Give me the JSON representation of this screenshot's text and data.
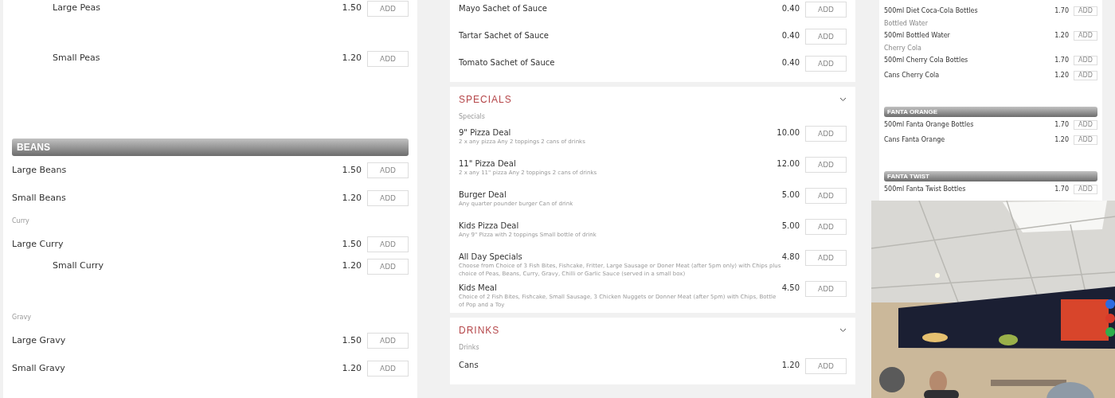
{
  "left_panel": {
    "rows": [
      {
        "kind": "item",
        "name": "Large Peas",
        "price": "1.50",
        "button": "ADD",
        "indented": true
      },
      {
        "kind": "item",
        "name": "Small Peas",
        "price": "1.20",
        "button": "ADD",
        "indented": true
      },
      {
        "kind": "banner",
        "title": "BEANS"
      },
      {
        "kind": "item",
        "name": "Large Beans",
        "price": "1.50",
        "button": "ADD",
        "indented": false
      },
      {
        "kind": "item",
        "name": "Small Beans",
        "price": "1.20",
        "button": "ADD",
        "indented": false
      },
      {
        "kind": "label",
        "title": "Curry"
      },
      {
        "kind": "item",
        "name": "Large Curry",
        "price": "1.50",
        "button": "ADD",
        "indented": false
      },
      {
        "kind": "item",
        "name": "Small Curry",
        "price": "1.20",
        "button": "ADD",
        "indented": true
      },
      {
        "kind": "label",
        "title": "Gravy"
      },
      {
        "kind": "item",
        "name": "Large Gravy",
        "price": "1.50",
        "button": "ADD",
        "indented": false
      },
      {
        "kind": "item",
        "name": "Small Gravy",
        "price": "1.20",
        "button": "ADD",
        "indented": false
      }
    ]
  },
  "middle_panel": {
    "cards": [
      {
        "rows": [
          {
            "name": "Mayo Sachet of Sauce",
            "price": "0.40",
            "button": "ADD"
          },
          {
            "name": "Tartar Sachet of Sauce",
            "price": "0.40",
            "button": "ADD"
          },
          {
            "name": "Tomato Sachet of Sauce",
            "price": "0.40",
            "button": "ADD"
          }
        ]
      },
      {
        "title": "SPECIALS",
        "label": "Specials",
        "rows": [
          {
            "name": "9\" Pizza Deal",
            "description": "2 x any pizza Any 2 toppings 2 cans of drinks",
            "price": "10.00",
            "button": "ADD"
          },
          {
            "name": "11\" Pizza Deal",
            "description": "2 x any 11\" pizza Any 2 toppings 2 cans of drinks",
            "price": "12.00",
            "button": "ADD"
          },
          {
            "name": "Burger Deal",
            "description": "Any quarter pounder burger Can of drink",
            "price": "5.00",
            "button": "ADD"
          },
          {
            "name": "Kids Pizza Deal",
            "description": "Any 9\" Pizza with 2 toppings Small bottle of drink",
            "price": "5.00",
            "button": "ADD"
          },
          {
            "name": "All Day Specials",
            "description": "Choose from Choice of 3 Fish Bites, Fishcake, Fritter, Large Sausage or Doner Meat (after 5pm only) with Chips plus choice of Peas, Beans, Curry, Gravy, Chilli or Garlic Sauce (served in a small box)",
            "price": "4.80",
            "button": "ADD"
          },
          {
            "name": "Kids Meal",
            "description": "Choice of 2 Fish Bites, Fishcake, Small Sausage, 3 Chicken Nuggets or Donner Meat (after 5pm) with Chips, Bottle of Pop and a Toy",
            "price": "4.50",
            "button": "ADD"
          }
        ]
      },
      {
        "title": "DRINKS",
        "label": "Drinks",
        "rows": [
          {
            "name": "Cans",
            "price": "1.20",
            "button": "ADD"
          }
        ]
      }
    ]
  },
  "right_panel": {
    "rows": [
      {
        "kind": "item",
        "name": "500ml Diet Coca-Cola Bottles",
        "price": "1.70",
        "button": "ADD",
        "indented": false
      },
      {
        "kind": "label",
        "title": "Bottled Water"
      },
      {
        "kind": "item",
        "name": "500ml Bottled Water",
        "price": "1.20",
        "button": "ADD",
        "indented": false
      },
      {
        "kind": "label",
        "title": "Cherry Cola"
      },
      {
        "kind": "item",
        "name": "500ml Cherry Cola Bottles",
        "price": "1.70",
        "button": "ADD",
        "indented": false
      },
      {
        "kind": "item",
        "name": "Cans Cherry Cola",
        "price": "1.20",
        "button": "ADD",
        "indented": false
      },
      {
        "kind": "banner",
        "title": "FANTA ORANGE"
      },
      {
        "kind": "item",
        "name": "500ml Fanta Orange Bottles",
        "price": "1.70",
        "button": "ADD",
        "indented": false
      },
      {
        "kind": "item",
        "name": "Cans Fanta Orange",
        "price": "1.20",
        "button": "ADD",
        "indented": false
      },
      {
        "kind": "banner",
        "title": "FANTA TWIST"
      },
      {
        "kind": "item",
        "name": "500ml Fanta Twist Bottles",
        "price": "1.70",
        "button": "ADD",
        "indented": false
      }
    ]
  }
}
